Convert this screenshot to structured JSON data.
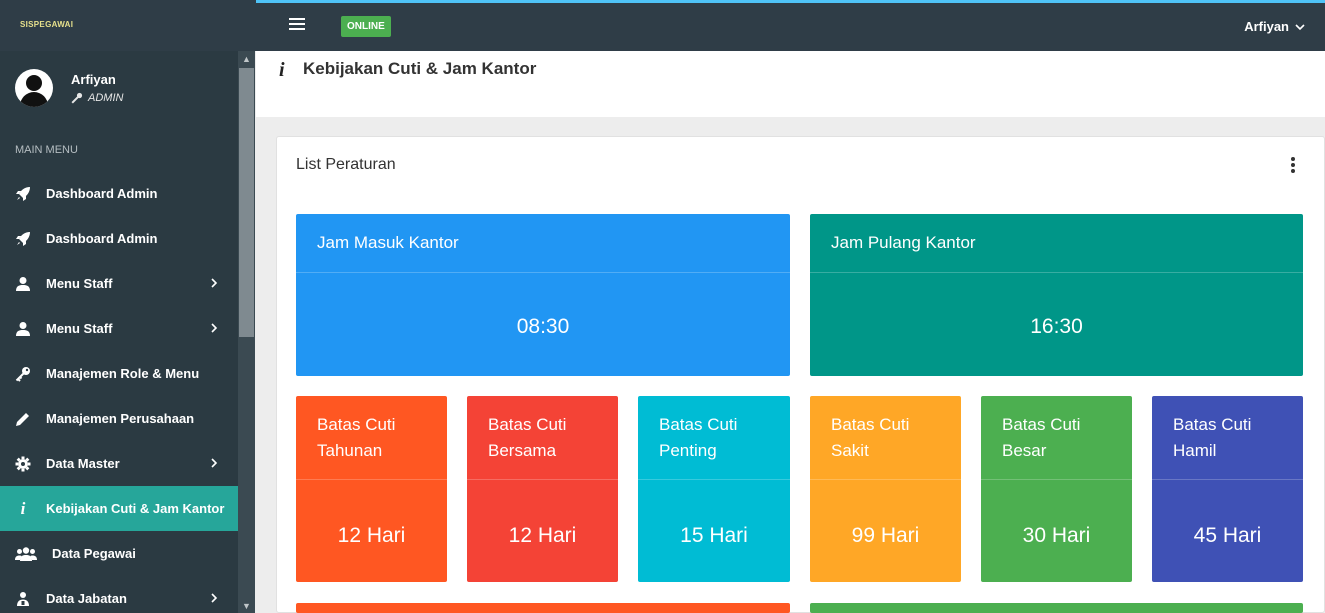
{
  "app": {
    "brand": "SISPEGAWAI",
    "status_badge": "ONLINE",
    "user_menu_label": "Arfiyan"
  },
  "sidebar": {
    "profile": {
      "name": "Arfiyan",
      "role": "ADMIN"
    },
    "menu_title": "MAIN MENU",
    "items": [
      {
        "label": "Dashboard Admin",
        "icon": "rocket-icon",
        "has_submenu": false,
        "active": false
      },
      {
        "label": "Dashboard Admin",
        "icon": "rocket-icon",
        "has_submenu": false,
        "active": false
      },
      {
        "label": "Menu Staff",
        "icon": "user-icon",
        "has_submenu": true,
        "active": false
      },
      {
        "label": "Menu Staff",
        "icon": "user-icon",
        "has_submenu": true,
        "active": false
      },
      {
        "label": "Manajemen Role & Menu",
        "icon": "key-icon",
        "has_submenu": false,
        "active": false
      },
      {
        "label": "Manajemen Perusahaan",
        "icon": "pencil-icon",
        "has_submenu": false,
        "active": false
      },
      {
        "label": "Data Master",
        "icon": "gear-icon",
        "has_submenu": true,
        "active": false
      },
      {
        "label": "Kebijakan Cuti & Jam Kantor",
        "icon": "info-icon",
        "has_submenu": false,
        "active": true
      },
      {
        "label": "Data Pegawai",
        "icon": "users-icon",
        "has_submenu": false,
        "active": false
      },
      {
        "label": "Data Jabatan",
        "icon": "sitemap-icon",
        "has_submenu": true,
        "active": false
      }
    ]
  },
  "page": {
    "title": "Kebijakan Cuti & Jam Kantor",
    "card_title": "List Peraturan"
  },
  "tiles": {
    "jam_masuk": {
      "label": "Jam Masuk Kantor",
      "value": "08:30",
      "color": "#2196f3"
    },
    "jam_pulang": {
      "label": "Jam Pulang Kantor",
      "value": "16:30",
      "color": "#009688"
    },
    "cuti_tahunan": {
      "label_1": "Batas Cuti",
      "label_2": "Tahunan",
      "value": "12 Hari",
      "color": "#ff5722"
    },
    "cuti_bersama": {
      "label_1": "Batas Cuti",
      "label_2": "Bersama",
      "value": "12 Hari",
      "color": "#f44336"
    },
    "cuti_penting": {
      "label_1": "Batas Cuti",
      "label_2": "Penting",
      "value": "15 Hari",
      "color": "#00bcd4"
    },
    "cuti_sakit": {
      "label_1": "Batas Cuti",
      "label_2": "Sakit",
      "value": "99 Hari",
      "color": "#ffa726"
    },
    "cuti_besar": {
      "label_1": "Batas Cuti",
      "label_2": "Besar",
      "value": "30 Hari",
      "color": "#4caf50"
    },
    "cuti_hamil": {
      "label_1": "Batas Cuti",
      "label_2": "Hamil",
      "value": "45 Hari",
      "color": "#3f51b5"
    }
  },
  "colors": {
    "topbar": "#2f3d47",
    "sidebar": "#2b3a42",
    "active_item": "#26a69a",
    "online_badge": "#4caf50"
  }
}
